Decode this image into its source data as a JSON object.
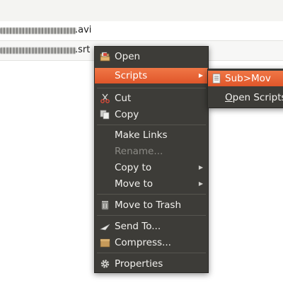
{
  "files": [
    {
      "name": ".avi"
    },
    {
      "name": ".srt"
    }
  ],
  "context_menu": {
    "open_label": "Open",
    "scripts_label": "Scripts",
    "cut_label": "Cut",
    "copy_label": "Copy",
    "make_links_label": "Make Links",
    "rename_label": "Rename...",
    "copy_to_label": "Copy to",
    "move_to_label": "Move to",
    "move_to_trash_label": "Move to Trash",
    "send_to_label": "Send To...",
    "compress_label": "Compress...",
    "properties_label": "Properties"
  },
  "scripts_submenu": {
    "sub_mov_label": "Sub>Mov",
    "open_scripts_rest": "pen Scripts",
    "open_scripts_mnemonic": "O"
  },
  "colors": {
    "menu_bg": "#3d3c38",
    "highlight": "#e9642f",
    "menu_text": "#f2f1ee",
    "disabled_text": "#8b8a85"
  }
}
